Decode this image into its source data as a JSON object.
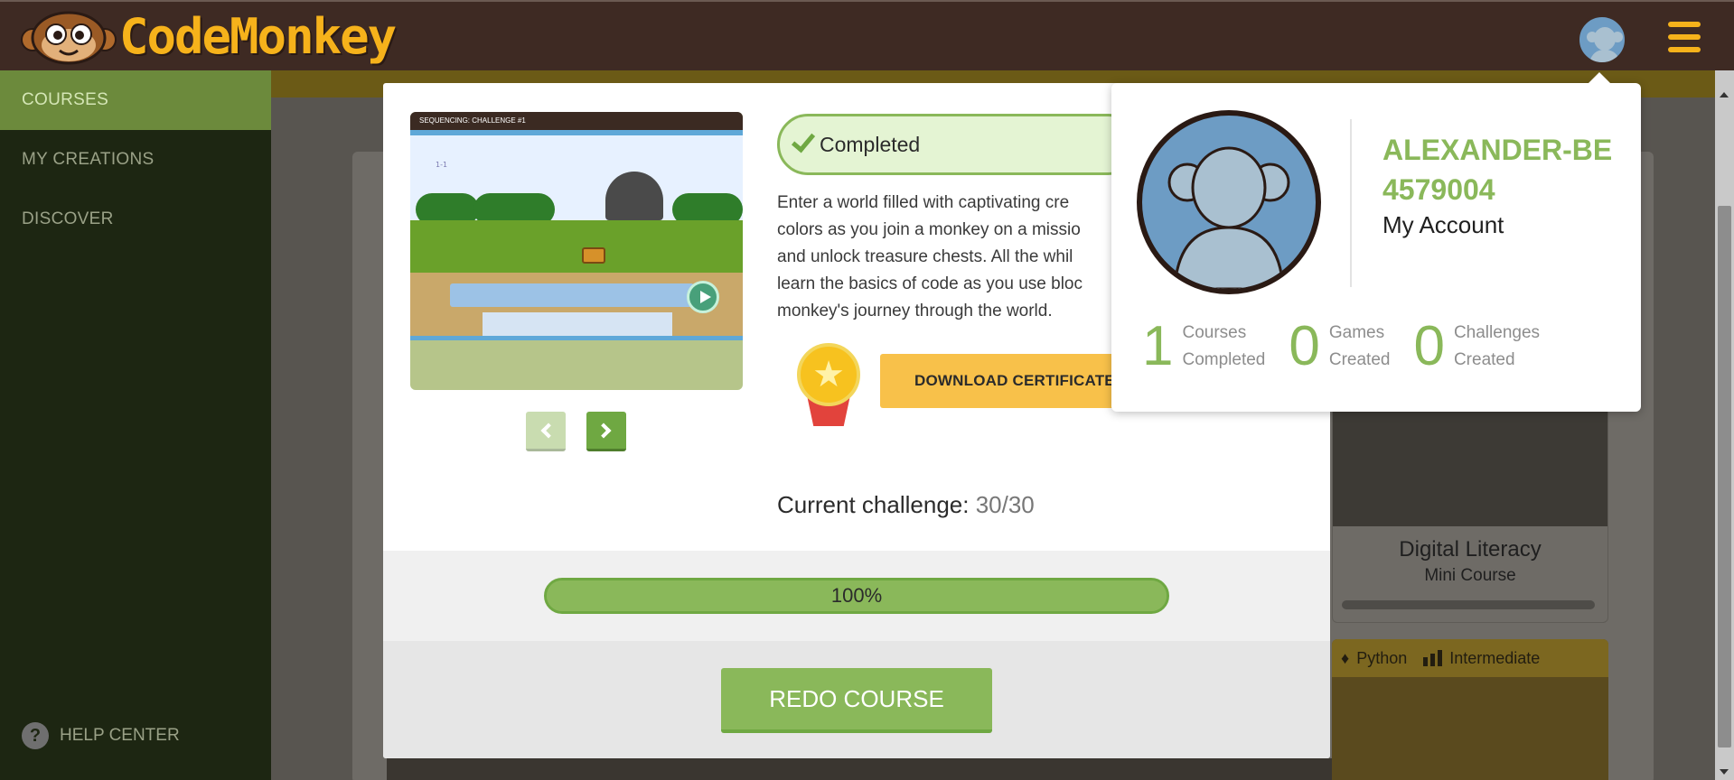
{
  "header": {
    "logo_text": "CodeMonkey",
    "avatar_icon": "user-avatar-icon",
    "menu_icon": "hamburger-menu-icon"
  },
  "sidebar": {
    "items": [
      {
        "label": "COURSES",
        "active": true
      },
      {
        "label": "MY CREATIONS",
        "active": false
      },
      {
        "label": "DISCOVER",
        "active": false
      }
    ],
    "help_label": "HELP CENTER",
    "help_icon": "question-icon"
  },
  "modal": {
    "preview": {
      "header": "SEQUENCING: CHALLENGE #1",
      "level_label": "1-1"
    },
    "status": "Completed",
    "description": [
      "Enter a world filled with captivating cre",
      "colors as you join a monkey on a missio",
      "and unlock treasure chests. All the whil",
      "learn the basics of code as you use bloc",
      "monkey's journey through the world."
    ],
    "download_label": "DOWNLOAD CERTIFICATE",
    "current_challenge_label": "Current challenge:",
    "current_challenge_value": "30/30",
    "progress_percent": 100,
    "progress_label": "100%",
    "redo_label": "REDO COURSE"
  },
  "background": {
    "card_title": "Digital Literacy",
    "card_subtitle": "Mini Course",
    "tag_language": "Python",
    "tag_level": "Intermediate"
  },
  "account_popup": {
    "username": "ALEXANDER-BE4579004",
    "my_account_label": "My Account",
    "stats": [
      {
        "value": "1",
        "label_1": "Courses",
        "label_2": "Completed"
      },
      {
        "value": "0",
        "label_1": "Games",
        "label_2": "Created"
      },
      {
        "value": "0",
        "label_1": "Challenges",
        "label_2": "Created"
      }
    ]
  },
  "colors": {
    "brand_brown": "#3e2a23",
    "brand_yellow": "#f6b21b",
    "accent_green": "#8ab85a",
    "sidebar_bg": "#1d2612",
    "certificate_yellow": "#f8c14a"
  }
}
